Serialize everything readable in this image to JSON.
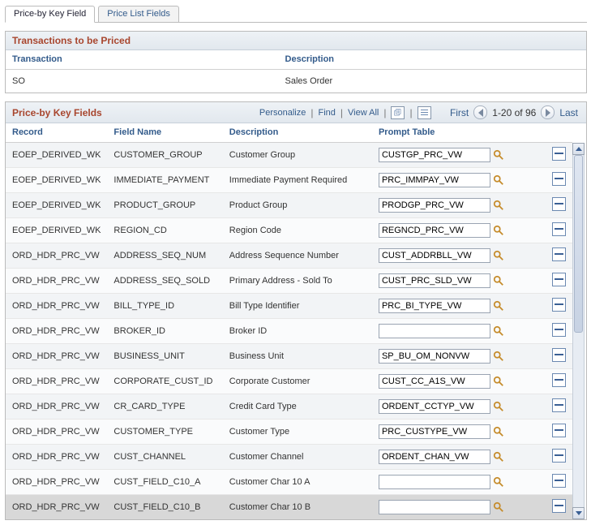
{
  "tabs": {
    "active": "Price-by Key Field",
    "other": "Price List Fields"
  },
  "transactions": {
    "title": "Transactions to be Priced",
    "columns": {
      "transaction": "Transaction",
      "description": "Description"
    },
    "rows": [
      {
        "transaction": "SO",
        "description": "Sales Order"
      }
    ]
  },
  "key_fields": {
    "title": "Price-by Key Fields",
    "links": {
      "personalize": "Personalize",
      "find": "Find",
      "view_all": "View All"
    },
    "nav": {
      "first": "First",
      "range": "1-20 of 96",
      "last": "Last"
    },
    "columns": {
      "record": "Record",
      "field": "Field Name",
      "description": "Description",
      "prompt": "Prompt Table"
    },
    "rows": [
      {
        "record": "EOEP_DERIVED_WK",
        "field": "CUSTOMER_GROUP",
        "description": "Customer Group",
        "prompt": "CUSTGP_PRC_VW"
      },
      {
        "record": "EOEP_DERIVED_WK",
        "field": "IMMEDIATE_PAYMENT",
        "description": "Immediate Payment Required",
        "prompt": "PRC_IMMPAY_VW"
      },
      {
        "record": "EOEP_DERIVED_WK",
        "field": "PRODUCT_GROUP",
        "description": "Product Group",
        "prompt": "PRODGP_PRC_VW"
      },
      {
        "record": "EOEP_DERIVED_WK",
        "field": "REGION_CD",
        "description": "Region Code",
        "prompt": "REGNCD_PRC_VW"
      },
      {
        "record": "ORD_HDR_PRC_VW",
        "field": "ADDRESS_SEQ_NUM",
        "description": "Address Sequence Number",
        "prompt": "CUST_ADDRBLL_VW"
      },
      {
        "record": "ORD_HDR_PRC_VW",
        "field": "ADDRESS_SEQ_SOLD",
        "description": "Primary Address - Sold To",
        "prompt": "CUST_PRC_SLD_VW"
      },
      {
        "record": "ORD_HDR_PRC_VW",
        "field": "BILL_TYPE_ID",
        "description": "Bill Type Identifier",
        "prompt": "PRC_BI_TYPE_VW"
      },
      {
        "record": "ORD_HDR_PRC_VW",
        "field": "BROKER_ID",
        "description": "Broker ID",
        "prompt": ""
      },
      {
        "record": "ORD_HDR_PRC_VW",
        "field": "BUSINESS_UNIT",
        "description": "Business Unit",
        "prompt": "SP_BU_OM_NONVW"
      },
      {
        "record": "ORD_HDR_PRC_VW",
        "field": "CORPORATE_CUST_ID",
        "description": "Corporate Customer",
        "prompt": "CUST_CC_A1S_VW"
      },
      {
        "record": "ORD_HDR_PRC_VW",
        "field": "CR_CARD_TYPE",
        "description": "Credit Card Type",
        "prompt": "ORDENT_CCTYP_VW"
      },
      {
        "record": "ORD_HDR_PRC_VW",
        "field": "CUSTOMER_TYPE",
        "description": "Customer Type",
        "prompt": "PRC_CUSTYPE_VW"
      },
      {
        "record": "ORD_HDR_PRC_VW",
        "field": "CUST_CHANNEL",
        "description": "Customer Channel",
        "prompt": "ORDENT_CHAN_VW"
      },
      {
        "record": "ORD_HDR_PRC_VW",
        "field": "CUST_FIELD_C10_A",
        "description": "Customer Char 10 A",
        "prompt": ""
      },
      {
        "record": "ORD_HDR_PRC_VW",
        "field": "CUST_FIELD_C10_B",
        "description": "Customer Char 10 B",
        "prompt": ""
      }
    ]
  }
}
